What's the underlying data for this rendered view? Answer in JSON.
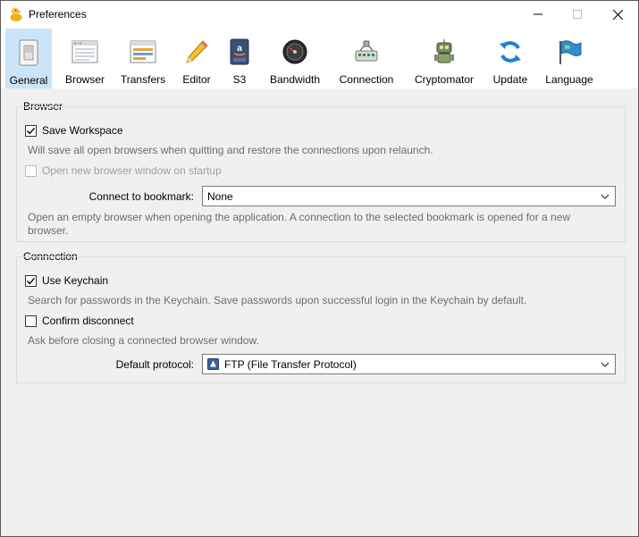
{
  "window": {
    "title": "Preferences"
  },
  "toolbar": {
    "items": [
      {
        "label": "General",
        "icon": "general-icon",
        "selected": true
      },
      {
        "label": "Browser",
        "icon": "browser-icon"
      },
      {
        "label": "Transfers",
        "icon": "transfers-icon"
      },
      {
        "label": "Editor",
        "icon": "pencil-icon"
      },
      {
        "label": "S3",
        "icon": "amazon-s3-icon"
      },
      {
        "label": "Bandwidth",
        "icon": "speedometer-icon"
      },
      {
        "label": "Connection",
        "icon": "network-icon"
      },
      {
        "label": "Cryptomator",
        "icon": "robot-icon"
      },
      {
        "label": "Update",
        "icon": "refresh-icon"
      },
      {
        "label": "Language",
        "icon": "flag-icon"
      }
    ]
  },
  "browser_group": {
    "title": "Browser",
    "save_workspace": {
      "label": "Save Workspace",
      "checked": true
    },
    "save_workspace_desc": "Will save all open browsers when quitting and restore the connections upon relaunch.",
    "open_new_window": {
      "label": "Open new browser window on startup",
      "checked": false,
      "disabled": true
    },
    "connect_bookmark_label": "Connect to bookmark:",
    "connect_bookmark_value": "None",
    "connect_bookmark_desc_1": "Open an empty browser when opening the application. A connection to the selected bookmark is opened for a new",
    "connect_bookmark_desc_2": "browser."
  },
  "connection_group": {
    "title": "Connection",
    "use_keychain": {
      "label": "Use Keychain",
      "checked": true
    },
    "use_keychain_desc": "Search for passwords in the Keychain. Save passwords upon successful login in the Keychain by default.",
    "confirm_disconnect": {
      "label": "Confirm disconnect",
      "checked": false
    },
    "confirm_disconnect_desc": "Ask before closing a connected browser window.",
    "default_protocol_label": "Default protocol:",
    "default_protocol_value": "FTP (File Transfer Protocol)"
  },
  "colors": {
    "selected_tab": "#cce4f7",
    "accent": "#0078d7"
  }
}
